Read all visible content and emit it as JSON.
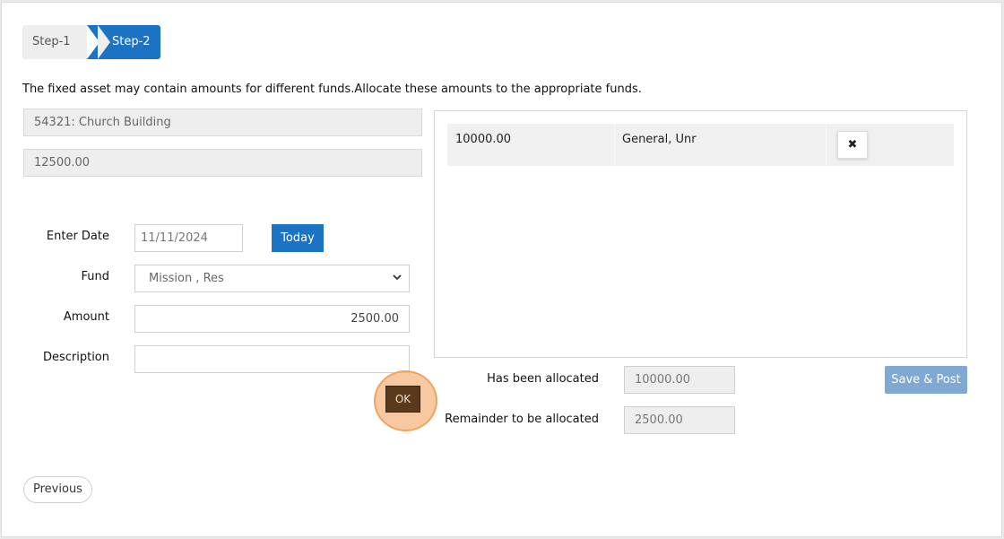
{
  "wizard": {
    "steps": [
      {
        "label": "Step-1",
        "active": false
      },
      {
        "label": "Step-2",
        "active": true
      }
    ]
  },
  "intro_text": "The fixed asset may contain amounts for different funds.Allocate these amounts to the appropriate funds.",
  "asset": {
    "name": "54321: Church Building",
    "total": "12500.00"
  },
  "form": {
    "date_label": "Enter Date",
    "date_value": "11/11/2024",
    "today_button": "Today",
    "fund_label": "Fund",
    "fund_selected": "Mission , Res",
    "amount_label": "Amount",
    "amount_value": "2500.00",
    "description_label": "Description",
    "description_value": "",
    "ok_button": "OK"
  },
  "allocations": [
    {
      "amount": "10000.00",
      "fund": "General, Unr",
      "remove_glyph": "✖"
    }
  ],
  "summary": {
    "allocated_label": "Has been allocated",
    "allocated_value": "10000.00",
    "remainder_label": "Remainder to be allocated",
    "remainder_value": "2500.00"
  },
  "buttons": {
    "save_post": "Save & Post",
    "previous": "Previous"
  },
  "colors": {
    "accent": "#1c73c4",
    "save_disabled": "#7fa8d3",
    "ok_button": "#5b3a1b",
    "highlight_ring": "#f0a35e"
  },
  "icons": {
    "fund_select": "chevron-down-icon",
    "remove": "close-icon"
  }
}
